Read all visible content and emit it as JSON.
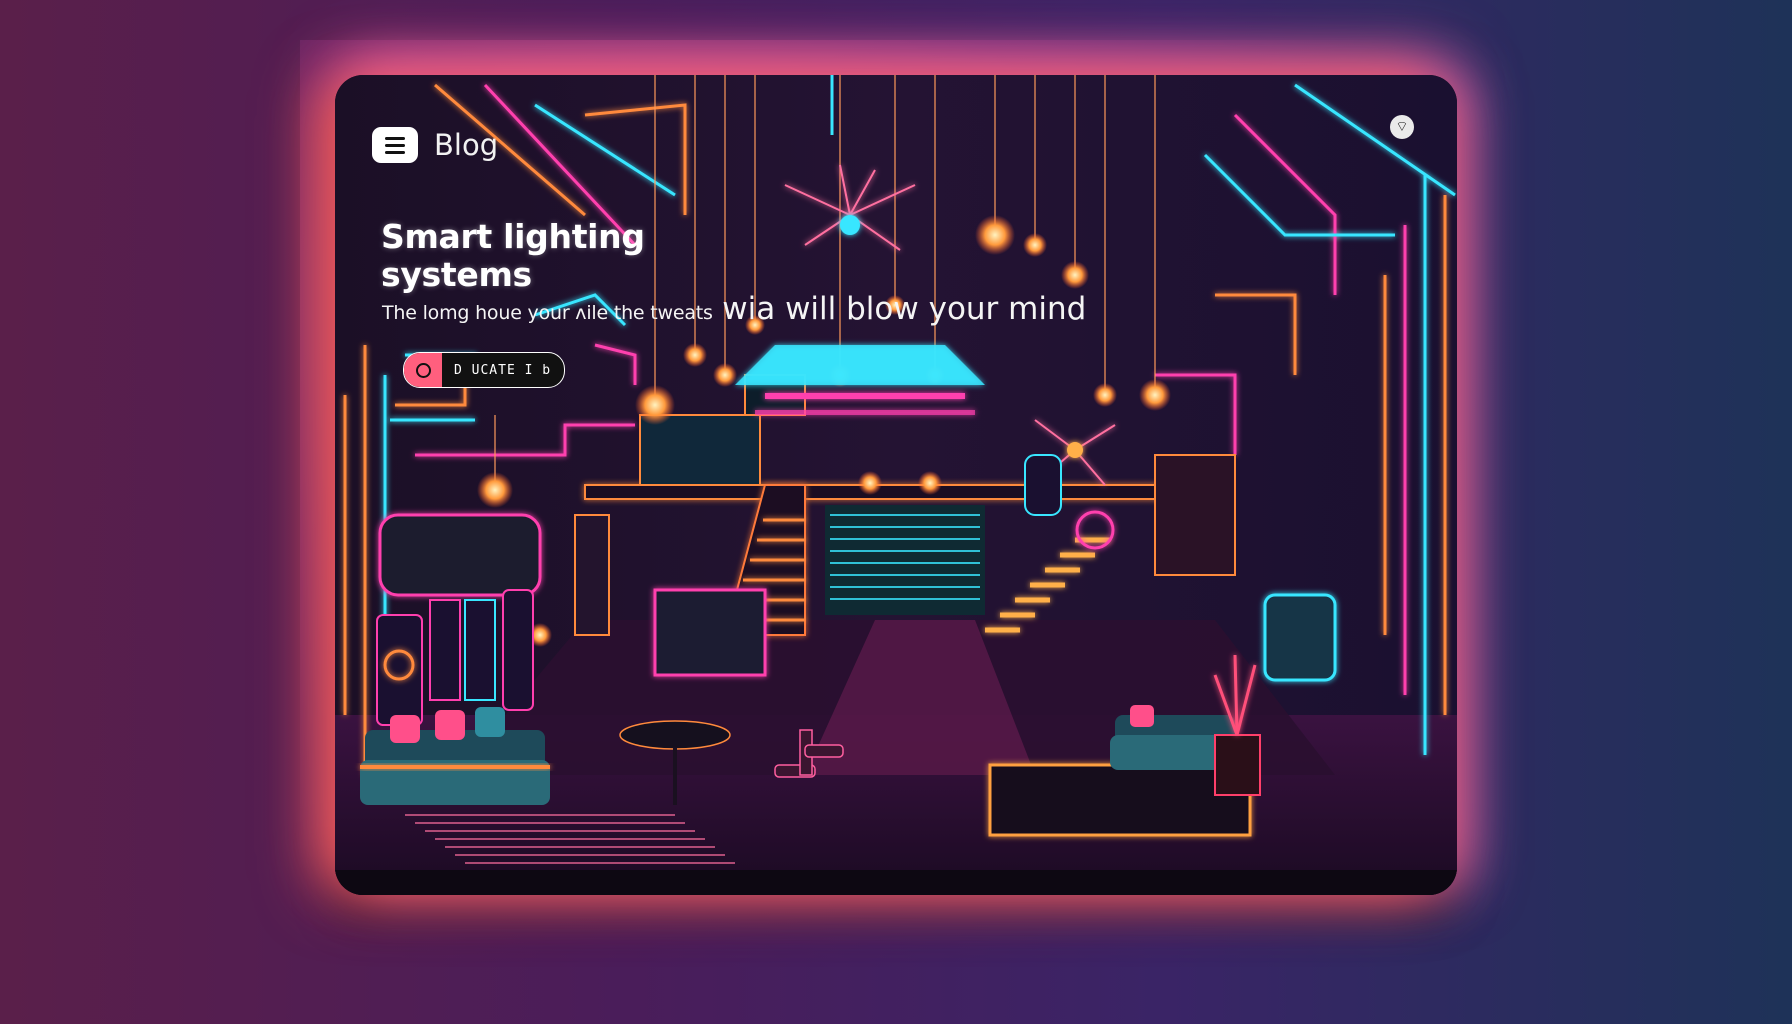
{
  "header": {
    "menu_icon": "hamburger-menu-icon",
    "brand": "Blog",
    "right_icon": "wifi-icon"
  },
  "hero": {
    "title_line1": "Smart lighting",
    "title_line2": "systems",
    "subtitle_small": "The lomg houe your ʌile the tweats",
    "subtitle_big": "wia  will  blow your mind"
  },
  "cta": {
    "label": "D UCATE  I  b",
    "icon": "record-icon"
  },
  "colors": {
    "accent_pink": "#ff5f7e",
    "neon_cyan": "#39e6ff",
    "neon_orange": "#ff8a3c",
    "neon_magenta": "#ff3fae",
    "background": "#120c1c"
  }
}
